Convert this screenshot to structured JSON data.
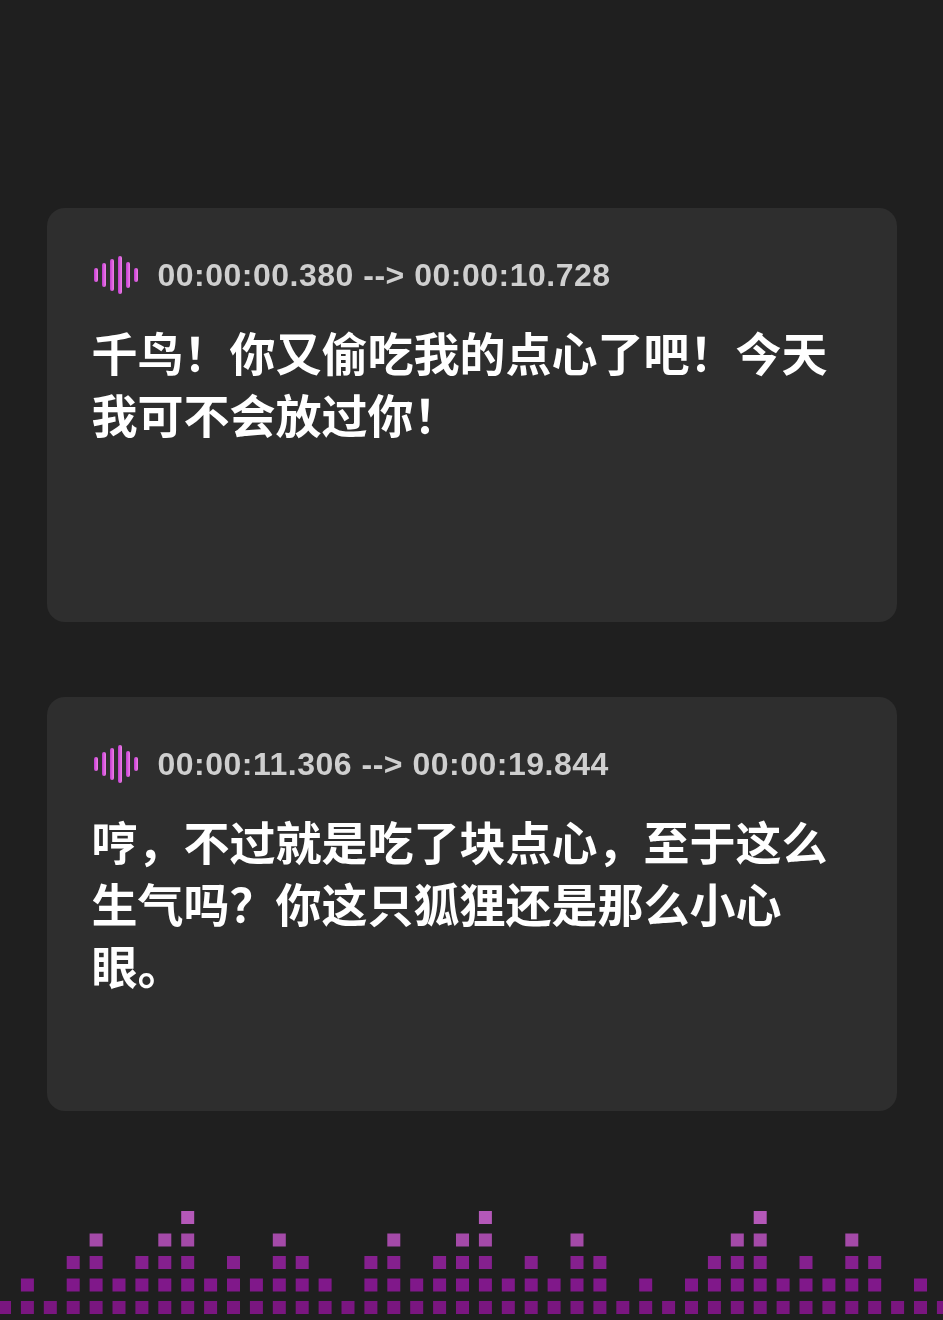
{
  "cues": [
    {
      "timestamp": "00:00:00.380 --> 00:00:10.728",
      "text": "千鸟！你又偷吃我的点心了吧！今天我可不会放过你！"
    },
    {
      "timestamp": "00:00:11.306 --> 00:00:19.844",
      "text": "哼，不过就是吃了块点心，至于这么生气吗？你这只狐狸还是那么小心眼。"
    }
  ]
}
